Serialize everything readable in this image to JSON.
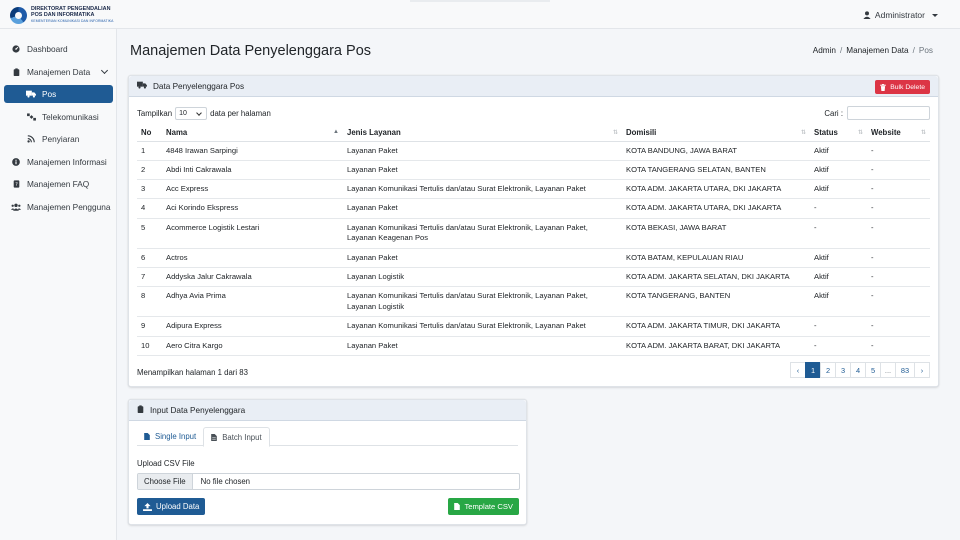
{
  "brand": {
    "line1": "DIREKTORAT PENGENDALIAN",
    "line2": "POS DAN INFORMATIKA",
    "line3": "KEMENTERIAN KOMUNIKASI DAN INFORMATIKA"
  },
  "user": {
    "name": "Administrator",
    "icon": "user-icon"
  },
  "sidebar": {
    "items": [
      {
        "label": "Dashboard",
        "icon": "dashboard-icon"
      },
      {
        "label": "Manajemen Data",
        "icon": "clipboard-icon"
      },
      {
        "label": "Pos",
        "icon": "truck-icon",
        "active": true
      },
      {
        "label": "Telekomunikasi",
        "icon": "satellite-icon"
      },
      {
        "label": "Penyiaran",
        "icon": "broadcast-icon"
      },
      {
        "label": "Manajemen Informasi",
        "icon": "info-icon"
      },
      {
        "label": "Manajemen FAQ",
        "icon": "question-icon"
      },
      {
        "label": "Manajemen Pengguna",
        "icon": "users-icon"
      }
    ]
  },
  "page": {
    "title": "Manajemen Data Penyelenggara Pos",
    "breadcrumb": [
      "Admin",
      "Manajemen Data",
      "Pos"
    ]
  },
  "data_card": {
    "title": "Data Penyelenggara Pos",
    "bulk_delete": "Bulk Delete",
    "show_prefix": "Tampilkan",
    "show_value": "10",
    "show_suffix": "data per halaman",
    "search_label": "Cari :",
    "columns": [
      "No",
      "Nama",
      "Jenis Layanan",
      "Domisili",
      "Status",
      "Website"
    ],
    "rows": [
      [
        "1",
        "4848 Irawan Sarpingi",
        "Layanan Paket",
        "KOTA BANDUNG, JAWA BARAT",
        "Aktif",
        "-"
      ],
      [
        "2",
        "Abdi Inti Cakrawala",
        "Layanan Paket",
        "KOTA TANGERANG SELATAN, BANTEN",
        "Aktif",
        "-"
      ],
      [
        "3",
        "Acc Express",
        "Layanan Komunikasi Tertulis dan/atau Surat Elektronik, Layanan Paket",
        "KOTA ADM. JAKARTA UTARA, DKI JAKARTA",
        "Aktif",
        "-"
      ],
      [
        "4",
        "Aci Korindo Ekspress",
        "Layanan Paket",
        "KOTA ADM. JAKARTA UTARA, DKI JAKARTA",
        "-",
        "-"
      ],
      [
        "5",
        "Acommerce Logistik Lestari",
        "Layanan Komunikasi Tertulis dan/atau Surat Elektronik, Layanan Paket, Layanan Keagenan Pos",
        "KOTA BEKASI, JAWA BARAT",
        "-",
        "-"
      ],
      [
        "6",
        "Actros",
        "Layanan Paket",
        "KOTA BATAM, KEPULAUAN RIAU",
        "Aktif",
        "-"
      ],
      [
        "7",
        "Addyska Jalur Cakrawala",
        "Layanan Logistik",
        "KOTA ADM. JAKARTA SELATAN, DKI JAKARTA",
        "Aktif",
        "-"
      ],
      [
        "8",
        "Adhya Avia Prima",
        "Layanan Komunikasi Tertulis dan/atau Surat Elektronik, Layanan Paket, Layanan Logistik",
        "KOTA TANGERANG, BANTEN",
        "Aktif",
        "-"
      ],
      [
        "9",
        "Adipura Express",
        "Layanan Komunikasi Tertulis dan/atau Surat Elektronik, Layanan Paket",
        "KOTA ADM. JAKARTA TIMUR, DKI JAKARTA",
        "-",
        "-"
      ],
      [
        "10",
        "Aero Citra Kargo",
        "Layanan Paket",
        "KOTA ADM. JAKARTA BARAT, DKI JAKARTA",
        "-",
        "-"
      ]
    ],
    "info": "Menampilkan halaman 1 dari 83",
    "pagination": [
      "‹",
      "1",
      "2",
      "3",
      "4",
      "5",
      "...",
      "83",
      "›"
    ]
  },
  "input_card": {
    "title": "Input Data Penyelenggara",
    "tabs": [
      "Single Input",
      "Batch Input"
    ],
    "upload_label": "Upload CSV File",
    "choose_file": "Choose File",
    "file_status": "No file chosen",
    "upload_button": "Upload Data",
    "template_button": "Template CSV"
  },
  "colors": {
    "primary": "#1f5b94",
    "danger": "#dc3545",
    "success": "#28a745"
  }
}
